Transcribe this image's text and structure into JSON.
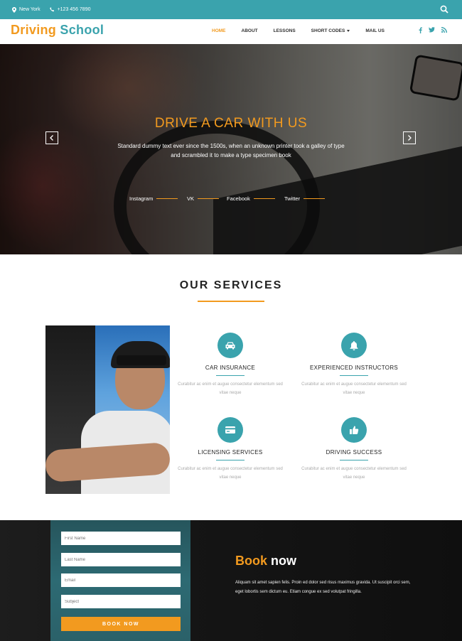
{
  "topbar": {
    "location": "New York",
    "phone": "+123 456 7890",
    "icons": [
      "map-pin-icon",
      "phone-icon",
      "search-icon"
    ]
  },
  "brand": {
    "word1": "Driving",
    "word2": "School"
  },
  "nav": {
    "items": [
      "HOME",
      "ABOUT",
      "LESSONS",
      "SHORT CODES",
      "MAIL US"
    ],
    "active": "HOME"
  },
  "social": [
    "facebook-icon",
    "twitter-icon",
    "rss-icon"
  ],
  "hero": {
    "title": "DRIVE A CAR WITH US",
    "text": "Standard dummy text ever since the 1500s, when an unknown printer took a galley of type and scrambled it to make a type specimen book",
    "links": [
      "Instagram",
      "VK",
      "Facebook",
      "Twitter"
    ]
  },
  "services": {
    "title": "OUR SERVICES",
    "items": [
      {
        "icon": "car-icon",
        "title": "CAR INSURANCE",
        "text": "Curabitur ac enim et augue consectetur elementum sed vitae neque"
      },
      {
        "icon": "bell-icon",
        "title": "EXPERIENCED INSTRUCTORS",
        "text": "Curabitur ac enim et augue consectetur elementum sed vitae neque"
      },
      {
        "icon": "credit-card-icon",
        "title": "LICENSING SERVICES",
        "text": "Curabitur ac enim et augue consectetur elementum sed vitae neque"
      },
      {
        "icon": "thumbs-up-icon",
        "title": "DRIVING SUCCESS",
        "text": "Curabitur ac enim et augue consectetur elementum sed vitae neque"
      }
    ]
  },
  "booking": {
    "title1": "Book",
    "title2": "now",
    "text": "Aliquam sit amet sapien felis. Proin ed dolor sed risus maximus gravida. Ut suscipit orci sem, eget lobortis sem dictum eu. Etiam congue ex sed volutpat fringilla.",
    "fields": {
      "first_name": "First Name",
      "last_name": "Last Name",
      "email": "Email",
      "subject": "Subject"
    },
    "button": "BOOK NOW"
  },
  "colors": {
    "teal": "#3aa3ad",
    "orange": "#f29a1f"
  }
}
